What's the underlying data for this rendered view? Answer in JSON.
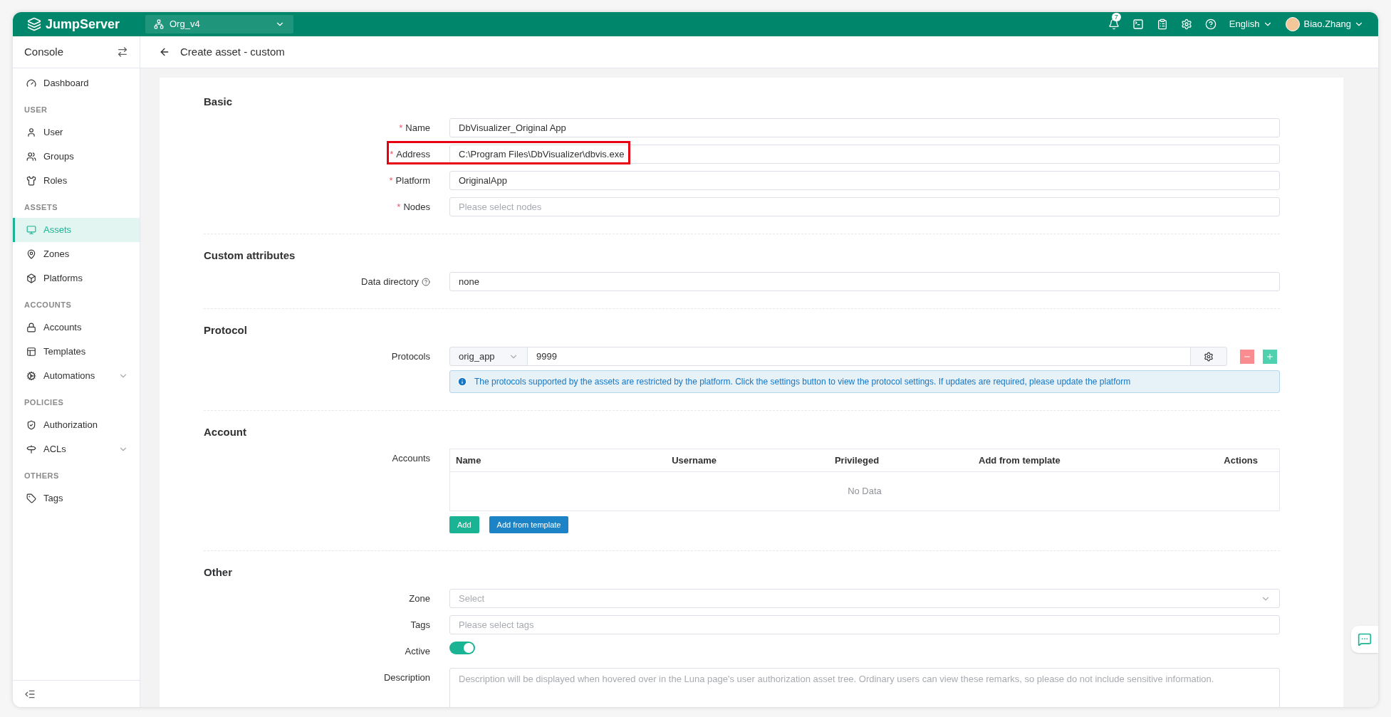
{
  "topbar": {
    "logo": "JumpServer",
    "org": "Org_v4",
    "notification_count": "7",
    "language": "English",
    "user": "Biao.Zhang"
  },
  "sidebar": {
    "title": "Console",
    "groups": [
      {
        "items": [
          {
            "label": "Dashboard",
            "selected": false
          }
        ]
      },
      {
        "heading": "USER",
        "items": [
          {
            "label": "User",
            "selected": false
          },
          {
            "label": "Groups",
            "selected": false
          },
          {
            "label": "Roles",
            "selected": false
          }
        ]
      },
      {
        "heading": "ASSETS",
        "items": [
          {
            "label": "Assets",
            "selected": true
          },
          {
            "label": "Zones",
            "selected": false
          },
          {
            "label": "Platforms",
            "selected": false
          }
        ]
      },
      {
        "heading": "ACCOUNTS",
        "items": [
          {
            "label": "Accounts",
            "selected": false
          },
          {
            "label": "Templates",
            "selected": false
          },
          {
            "label": "Automations",
            "selected": false,
            "expanded": false
          }
        ]
      },
      {
        "heading": "POLICIES",
        "items": [
          {
            "label": "Authorization",
            "selected": false
          },
          {
            "label": "ACLs",
            "selected": false,
            "expanded": false
          }
        ]
      },
      {
        "heading": "OTHERS",
        "items": [
          {
            "label": "Tags",
            "selected": false
          }
        ]
      }
    ]
  },
  "page_title": "Create asset - custom",
  "sections": [
    {
      "title": "Basic",
      "fields": [
        {
          "kind": "input",
          "required_mark": "*",
          "label": "Name",
          "value": "DbVisualizer_Original App"
        },
        {
          "kind": "input",
          "required_mark": "*",
          "label": "Address",
          "value": "C:\\Program Files\\DbVisualizer\\dbvis.exe",
          "highlighted": true
        },
        {
          "kind": "input",
          "required_mark": "*",
          "label": "Platform",
          "value": "OriginalApp"
        },
        {
          "kind": "input",
          "required_mark": "*",
          "label": "Nodes",
          "placeholder": "Please select nodes"
        }
      ]
    },
    {
      "title": "Custom attributes",
      "fields": [
        {
          "kind": "input",
          "label": "Data directory",
          "help": true,
          "value": "none"
        }
      ]
    },
    {
      "title": "Protocol",
      "fields": [
        {
          "kind": "protocols",
          "label": "Protocols",
          "protocol": "orig_app",
          "port": "9999",
          "info": "The protocols supported by the assets are restricted by the platform. Click the settings button to view the protocol settings. If updates are required, please update the platform"
        }
      ]
    },
    {
      "title": "Account",
      "fields": [
        {
          "kind": "table",
          "label": "Accounts",
          "columns": [
            "Name",
            "Username",
            "Privileged",
            "Add from template",
            "Actions"
          ],
          "empty_text": "No Data",
          "buttons": [
            "Add",
            "Add from template"
          ]
        }
      ]
    },
    {
      "title": "Other",
      "fields": [
        {
          "kind": "select",
          "label": "Zone",
          "placeholder": "Select"
        },
        {
          "kind": "input",
          "label": "Tags",
          "placeholder": "Please select tags"
        },
        {
          "kind": "toggle",
          "label": "Active",
          "on": true
        },
        {
          "kind": "textarea",
          "label": "Description",
          "placeholder": "Description will be displayed when hovered over in the Luna page's user authorization asset tree. Ordinary users can view these remarks, so please do not include sensitive information."
        }
      ]
    }
  ]
}
